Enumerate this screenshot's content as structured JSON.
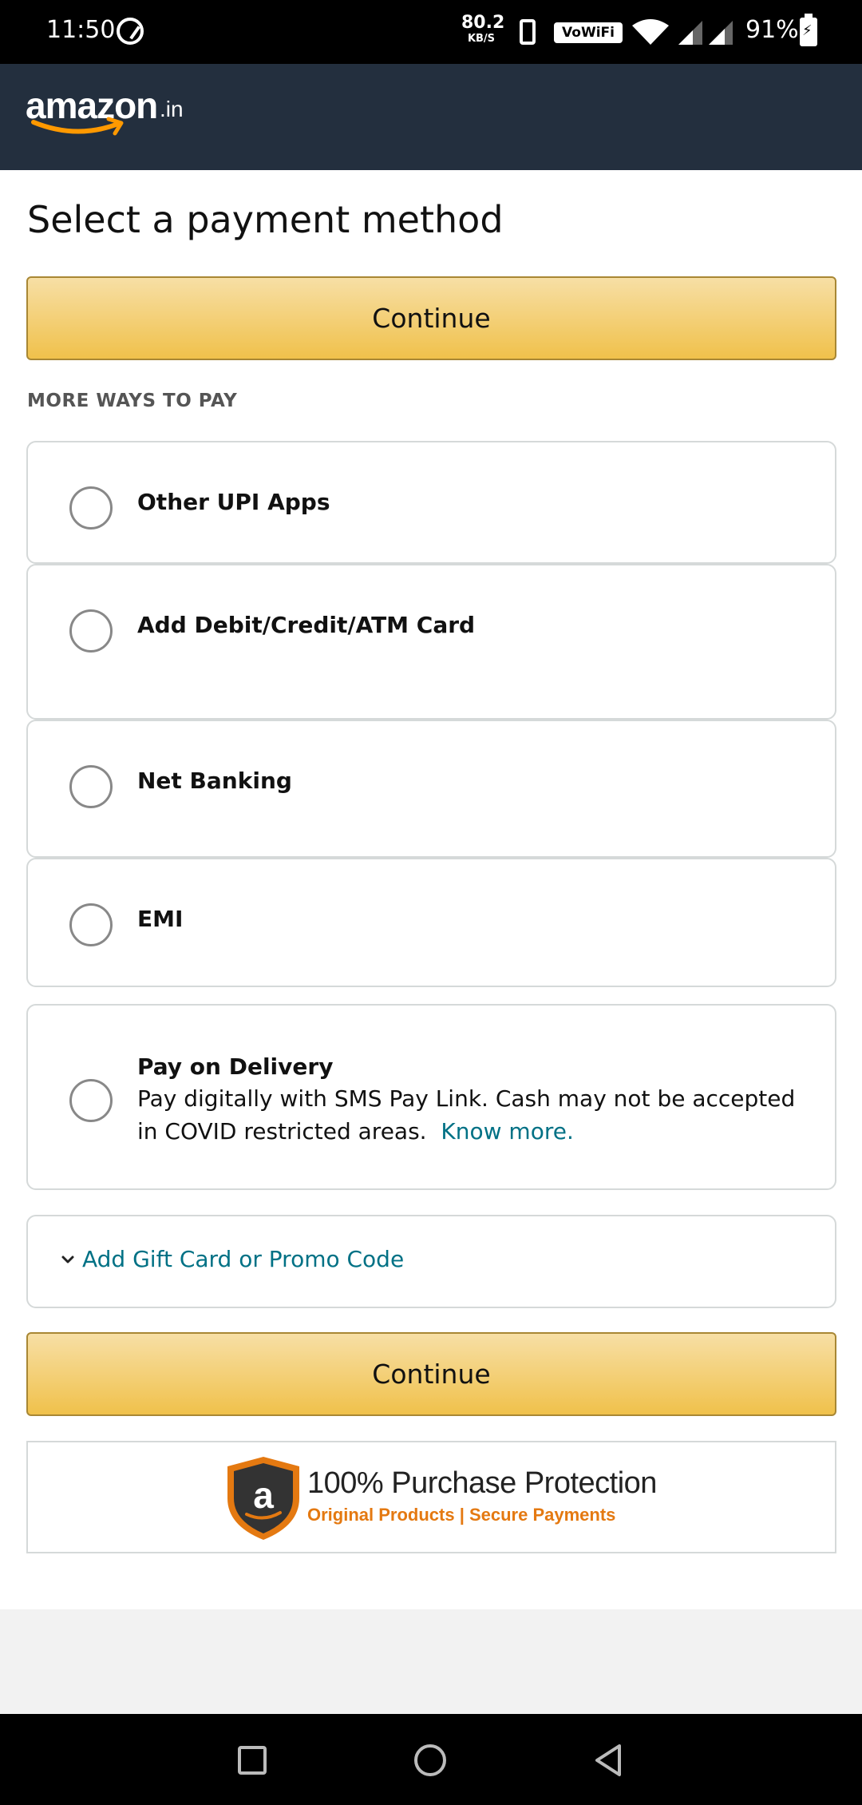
{
  "status_bar": {
    "time": "11:50",
    "net_speed_value": "80.2",
    "net_speed_unit": "KB/S",
    "wifi_badge": "VoWiFi",
    "battery": "91%"
  },
  "header": {
    "logo_text": "amazon",
    "logo_tld": ".in"
  },
  "page": {
    "title": "Select a payment method",
    "continue_label": "Continue",
    "section_label": "MORE WAYS TO PAY"
  },
  "payment_options": [
    {
      "label": "Other UPI Apps",
      "selected": false
    },
    {
      "label": "Add Debit/Credit/ATM Card",
      "selected": false
    },
    {
      "label": "Net Banking",
      "selected": false
    },
    {
      "label": "EMI",
      "selected": false
    },
    {
      "label": "Pay on Delivery",
      "description": "Pay digitally with SMS Pay Link. Cash may not be accepted in COVID restricted areas.",
      "link": "Know more.",
      "selected": false
    }
  ],
  "gift_card": {
    "label": "Add Gift Card or Promo Code",
    "icon": "chevron-down-icon"
  },
  "protection": {
    "title": "100% Purchase Protection",
    "subtitle": "Original Products | Secure Payments"
  },
  "colors": {
    "header_bg": "#232f3e",
    "button_top": "#f7dfa5",
    "button_bottom": "#f0c14b",
    "link": "#007185",
    "accent_orange": "#e47911"
  }
}
